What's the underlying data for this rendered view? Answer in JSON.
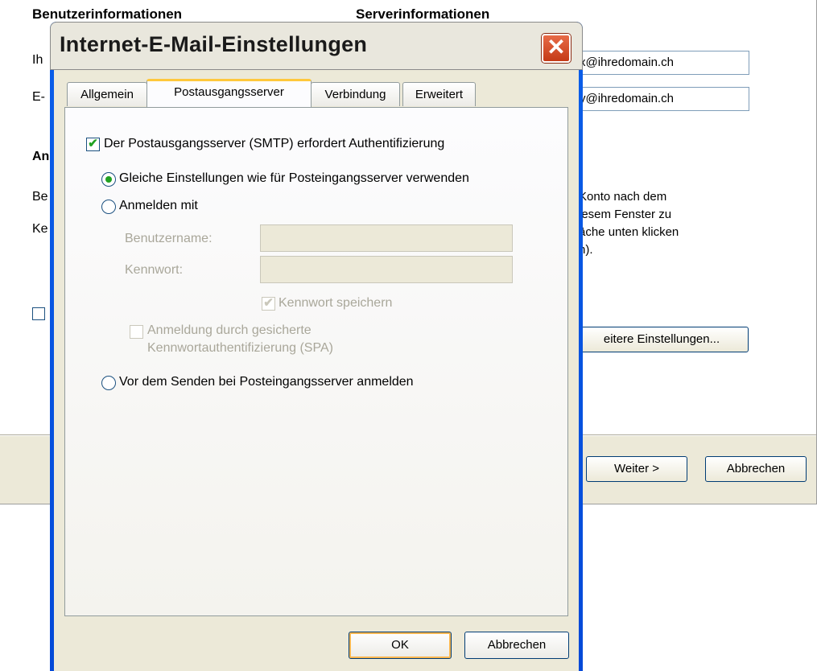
{
  "background": {
    "section_user_info": "Benutzerinformationen",
    "section_server_info": "Serverinformationen",
    "label_name_partial": "Ih",
    "label_email_partial": "E-",
    "label_login_partial": "An",
    "label_user_partial": "Be",
    "label_password_partial": "Ke",
    "field_email_1": "x@ihredomain.ch",
    "field_email_2": "y@ihredomain.ch",
    "info_text": [
      "Konto nach dem",
      "iesem Fenster zu",
      "äche unten klicken",
      "n)."
    ],
    "more_settings_button": "eitere Einstellungen...",
    "next_button": "Weiter >",
    "cancel_button": "Abbrechen"
  },
  "dialog": {
    "title": "Internet-E-Mail-Einstellungen",
    "close_glyph": "✕",
    "tabs": [
      {
        "label": "Allgemein",
        "active": false
      },
      {
        "label": "Postausgangsserver",
        "active": true
      },
      {
        "label": "Verbindung",
        "active": false
      },
      {
        "label": "Erweitert",
        "active": false
      }
    ],
    "smtp_auth_label": "Der Postausgangsserver (SMTP) erfordert Authentifizierung",
    "smtp_auth_checked": true,
    "radio_same_settings": "Gleiche Einstellungen wie für Posteingangsserver verwenden",
    "radio_login_with": "Anmelden mit",
    "username_label": "Benutzername:",
    "username_value": "",
    "password_label": "Kennwort:",
    "password_value": "",
    "save_password_label": "Kennwort speichern",
    "spa_label_line1": "Anmeldung durch gesicherte",
    "spa_label_line2": "Kennwortauthentifizierung (SPA)",
    "radio_login_before_send": "Vor dem Senden bei Posteingangsserver anmelden",
    "selected_option": "Gleiche Einstellungen wie für Posteingangsserver verwenden",
    "ok_button": "OK",
    "cancel_button": "Abbrechen"
  },
  "colors": {
    "check_green": "#21a121",
    "title_blue": "#0058ee",
    "active_tab_accent": "#ffc83c"
  }
}
